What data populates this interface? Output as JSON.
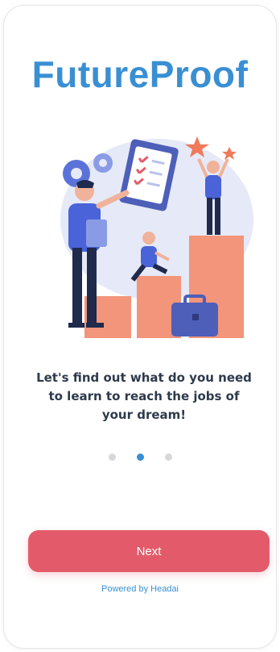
{
  "app": {
    "logo_text": "FutureProof",
    "logo_color": "#3a8fd3"
  },
  "onboarding": {
    "illustration_icon": "career-growth-illustration",
    "message": "Let's find out what do you need to learn to reach the jobs of your dream!",
    "page_indicator": {
      "total": 3,
      "active_index": 1
    }
  },
  "actions": {
    "next_label": "Next",
    "next_color": "#e35b6a"
  },
  "footer": {
    "powered_by": "Powered by Headai",
    "powered_by_color": "#3a8fd3"
  }
}
